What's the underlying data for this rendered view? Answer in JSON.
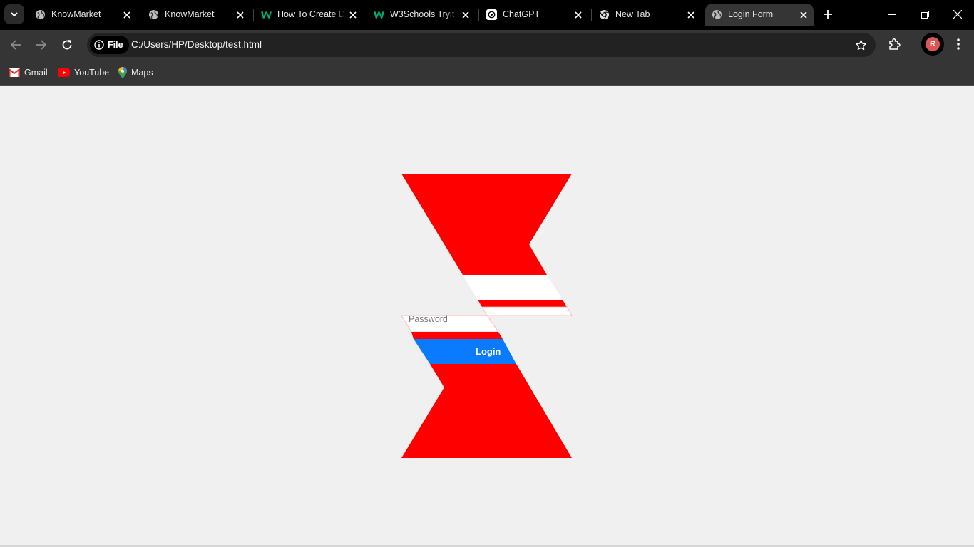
{
  "browser": {
    "tabs": [
      {
        "title": "KnowMarket",
        "icon": "globe-icon",
        "active": false
      },
      {
        "title": "KnowMarket",
        "icon": "globe-icon",
        "active": false
      },
      {
        "title": "How To Create D",
        "icon": "w3schools-icon",
        "active": false
      },
      {
        "title": "W3Schools Tryit",
        "icon": "w3schools-icon",
        "active": false
      },
      {
        "title": "ChatGPT",
        "icon": "chatgpt-icon",
        "active": false
      },
      {
        "title": "New Tab",
        "icon": "chrome-icon",
        "active": false
      },
      {
        "title": "Login Form",
        "icon": "globe-icon",
        "active": true
      }
    ],
    "address": {
      "chip_label": "File",
      "url": "C:/Users/HP/Desktop/test.html"
    },
    "profile_initial": "R",
    "bookmarks": [
      {
        "label": "Gmail",
        "icon": "gmail-icon"
      },
      {
        "label": "YouTube",
        "icon": "youtube-icon"
      },
      {
        "label": "Maps",
        "icon": "maps-icon"
      }
    ]
  },
  "page": {
    "password_placeholder": "Password",
    "login_button": "Login",
    "colors": {
      "background": "#f0f0f0",
      "primary_shape": "#ff0000",
      "button": "#0a7bff",
      "field": "#ffffff"
    }
  }
}
